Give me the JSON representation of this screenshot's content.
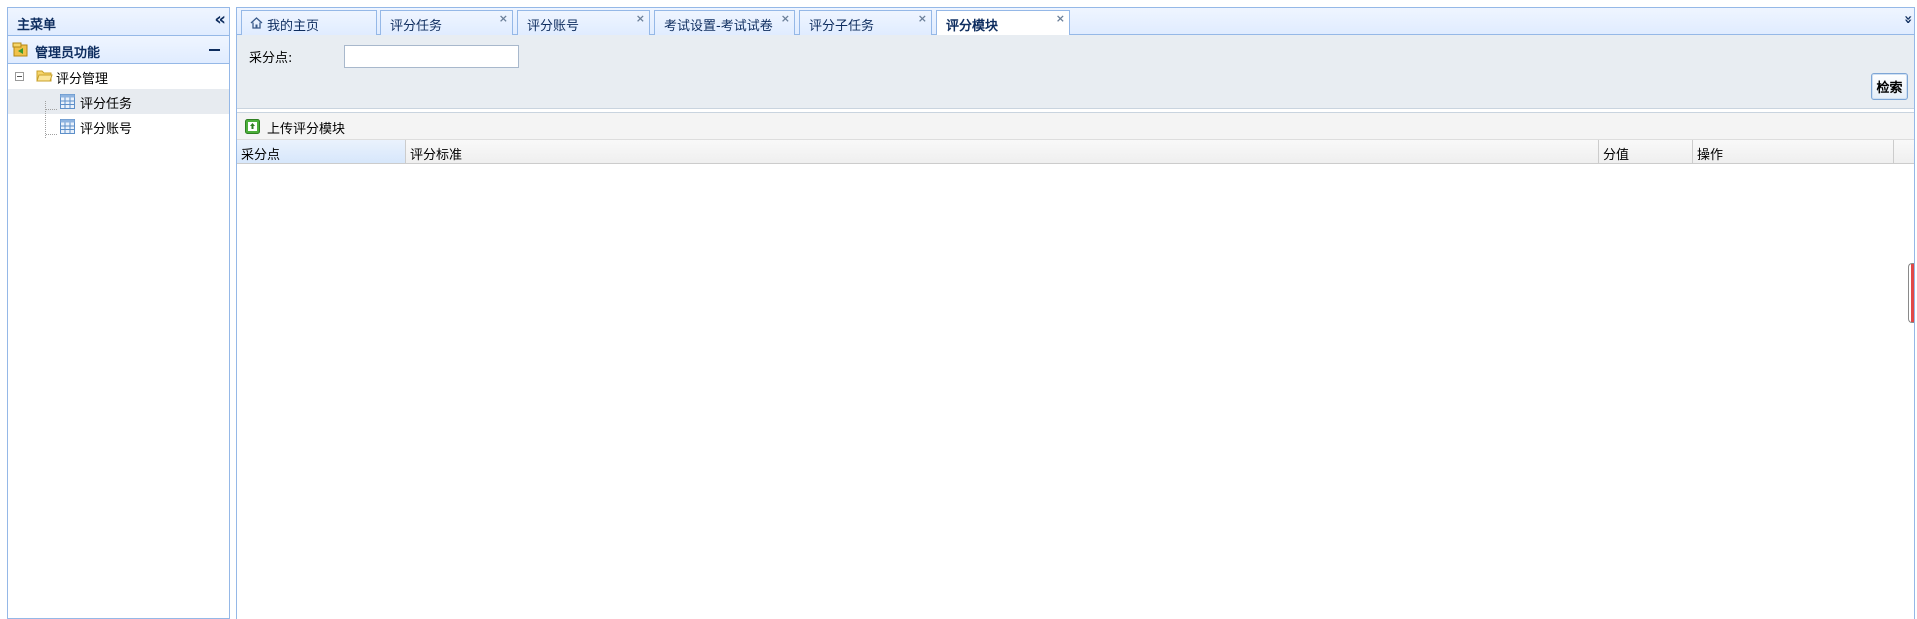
{
  "sidebar": {
    "title": "主菜单",
    "section_label": "管理员功能",
    "tree": {
      "root_label": "评分管理",
      "children": [
        {
          "label": "评分任务",
          "selected": true
        },
        {
          "label": "评分账号",
          "selected": false
        }
      ]
    }
  },
  "tabs": [
    {
      "label": "我的主页",
      "closable": false,
      "icon": "home-icon"
    },
    {
      "label": "评分任务",
      "closable": true
    },
    {
      "label": "评分账号",
      "closable": true
    },
    {
      "label": "考试设置-考试试卷",
      "closable": true
    },
    {
      "label": "评分子任务",
      "closable": true
    },
    {
      "label": "评分模块",
      "closable": true,
      "active": true
    }
  ],
  "close_glyph": "×",
  "search": {
    "field_label": "采分点:",
    "field_value": "",
    "button_label": "检索"
  },
  "toolbar": {
    "upload_label": "上传评分模块"
  },
  "grid": {
    "columns": [
      "采分点",
      "评分标准",
      "分值",
      "操作"
    ],
    "sorted_column": "采分点",
    "rows": []
  },
  "colors": {
    "border": "#95b8e7",
    "panel_header": "#e0ecff",
    "search_bg": "#e8edf2"
  }
}
